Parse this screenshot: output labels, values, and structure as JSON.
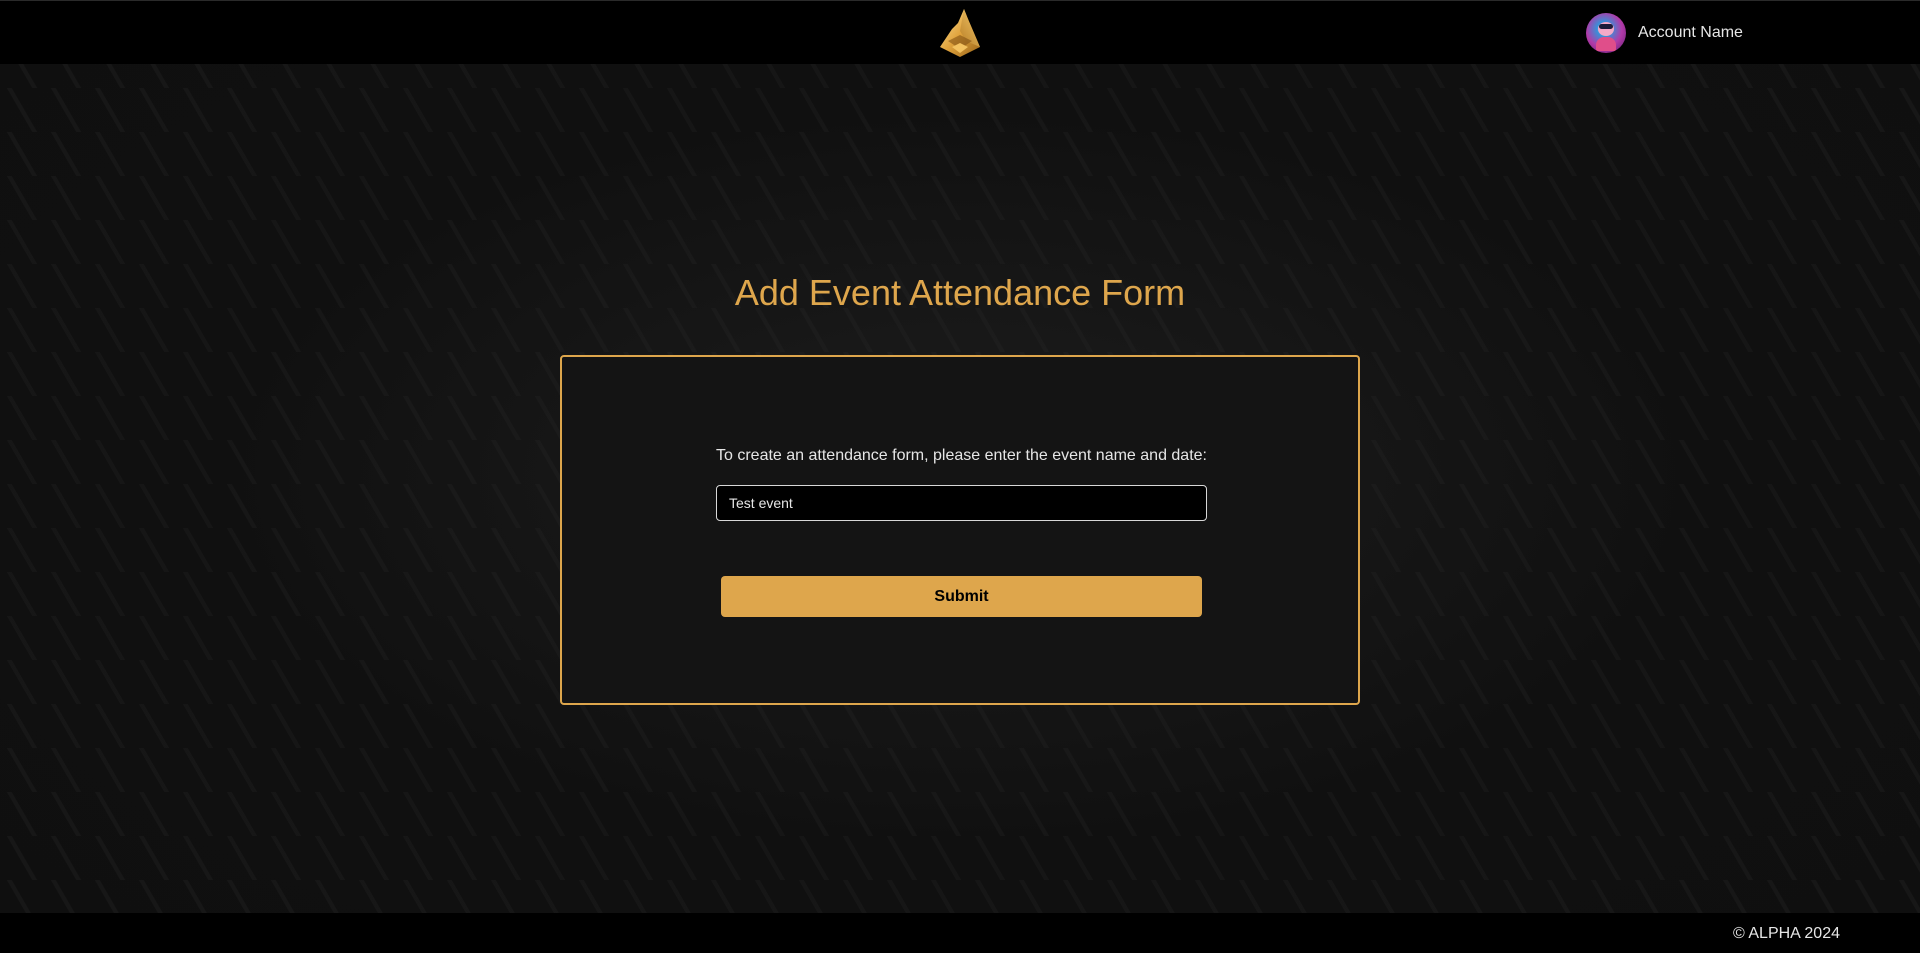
{
  "header": {
    "logo_icon": "wolf-head-logo-icon",
    "account": {
      "name": "Account Name",
      "avatar_icon": "user-avatar-icon"
    }
  },
  "main": {
    "title": "Add Event Attendance Form",
    "instructions": "To create an attendance form, please enter the event name and date:",
    "event_input": {
      "value": "Test event",
      "placeholder": ""
    },
    "submit_label": "Submit"
  },
  "footer": {
    "copyright": "© ALPHA 2024"
  },
  "colors": {
    "accent": "#dea64c",
    "background": "#0f0f0f",
    "header_background": "#000000",
    "card_background": "#141414"
  }
}
